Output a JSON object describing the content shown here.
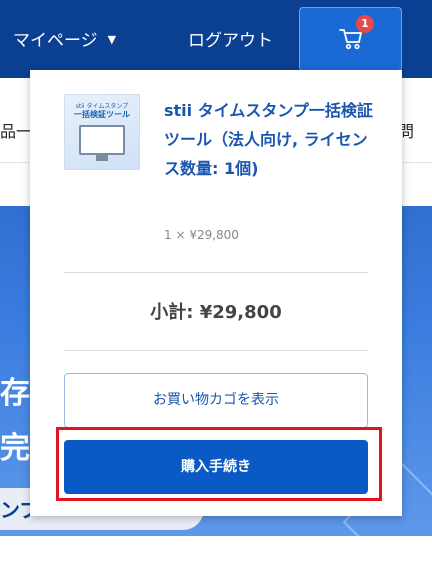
{
  "header": {
    "mypage_label": "マイページ",
    "mypage_chevron_icon": "chevron-down-icon",
    "logout_label": "ログアウト",
    "cart_icon": "shopping-cart-icon",
    "cart_count": "1"
  },
  "subnav": {
    "left_text": "品一",
    "right_text": "問"
  },
  "hero": {
    "line1": "存法",
    "line2": "完全",
    "pill_text": "ンプ"
  },
  "cart_dropdown": {
    "product": {
      "thumb_caption": "stii タイムスタンプ",
      "thumb_title": "一括検証ツール",
      "name": "stii タイムスタンプ一括検証ツール（法人向け, ライセンス数量: 1個)",
      "quantity_price": "1 × ¥29,800"
    },
    "subtotal_label": "小計: ¥29,800",
    "view_cart_label": "お買い物カゴを表示",
    "checkout_label": "購入手続き"
  },
  "colors": {
    "header_bg": "#0b3f92",
    "cart_button_bg": "#1a6ad6",
    "badge_bg": "#e44a4a",
    "link_blue": "#1a56b0",
    "checkout_bg": "#0a5ac6",
    "highlight_border": "#e2141e"
  }
}
